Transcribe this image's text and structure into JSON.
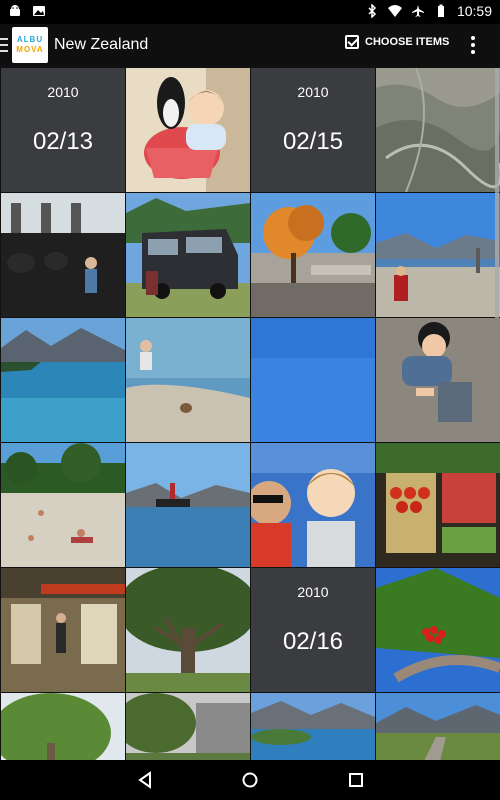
{
  "status_bar": {
    "time": "10:59",
    "left_icons": [
      "android-notification-icon",
      "photo-notification-icon"
    ],
    "right_icons": [
      "bluetooth-icon",
      "wifi-icon",
      "airplane-mode-icon",
      "battery-icon"
    ]
  },
  "app_bar": {
    "logo_line1": "ALBU",
    "logo_line2": "MOVA",
    "title": "New Zealand",
    "choose_items_label": "CHOOSE ITEMS",
    "overflow_icon": "more-vert-icon"
  },
  "grid": {
    "cells": [
      {
        "type": "date",
        "year": "2010",
        "date": "02/13"
      },
      {
        "type": "photo",
        "desc": "baby-with-penguin-toy"
      },
      {
        "type": "date",
        "year": "2010",
        "date": "02/15"
      },
      {
        "type": "photo",
        "desc": "aerial-mountain-view"
      },
      {
        "type": "photo",
        "desc": "cafe-interior-child"
      },
      {
        "type": "photo",
        "desc": "black-van-parked"
      },
      {
        "type": "photo",
        "desc": "town-street-tree"
      },
      {
        "type": "photo",
        "desc": "lakeside-promenade"
      },
      {
        "type": "photo",
        "desc": "mountain-lake"
      },
      {
        "type": "photo",
        "desc": "person-at-shore"
      },
      {
        "type": "photo",
        "desc": "blue-sky"
      },
      {
        "type": "photo",
        "desc": "child-on-pebbles"
      },
      {
        "type": "photo",
        "desc": "beach-with-people"
      },
      {
        "type": "photo",
        "desc": "steamship-on-lake"
      },
      {
        "type": "photo",
        "desc": "selfie-with-child"
      },
      {
        "type": "photo",
        "desc": "market-tomatoes"
      },
      {
        "type": "photo",
        "desc": "shop-interior"
      },
      {
        "type": "photo",
        "desc": "large-tree"
      },
      {
        "type": "date",
        "year": "2010",
        "date": "02/16"
      },
      {
        "type": "photo",
        "desc": "red-berries-tree"
      },
      {
        "type": "photo",
        "desc": "green-tree-canopy"
      },
      {
        "type": "photo",
        "desc": "trees-and-buildings"
      },
      {
        "type": "photo",
        "desc": "lake-panorama"
      },
      {
        "type": "photo",
        "desc": "mountain-road-view"
      }
    ]
  },
  "nav_bar": {
    "back_icon": "back-triangle-icon",
    "home_icon": "home-circle-icon",
    "recents_icon": "recents-square-icon"
  }
}
